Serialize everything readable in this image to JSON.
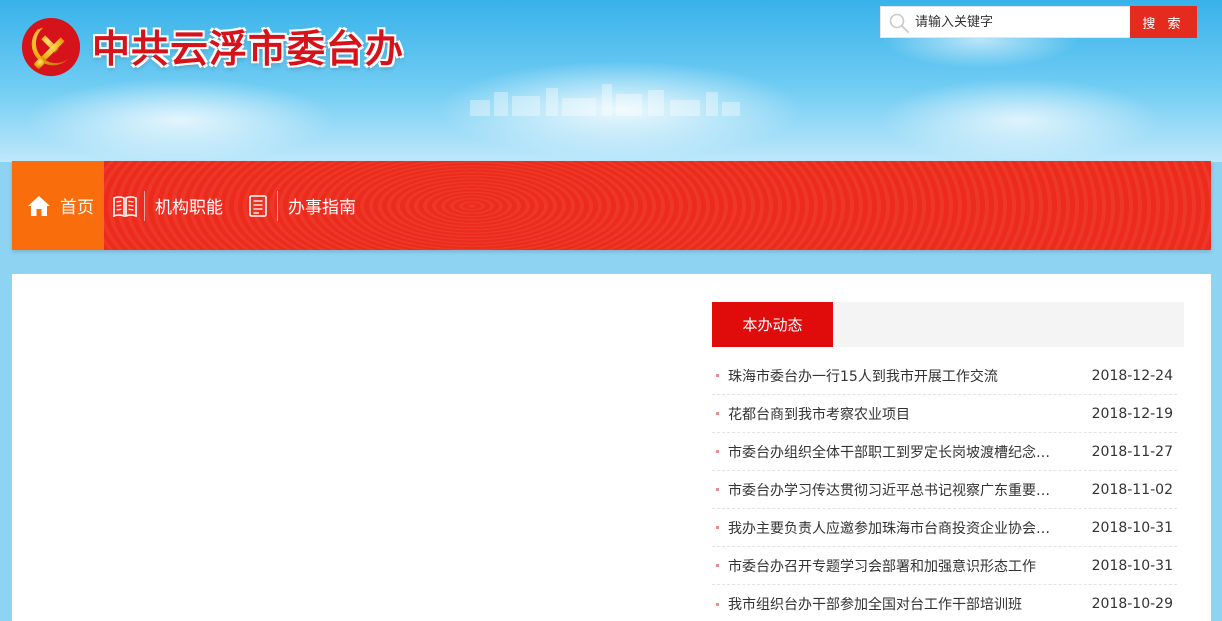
{
  "header": {
    "site_title": "中共云浮市委台办",
    "logo_icon": "party-emblem-icon"
  },
  "search": {
    "placeholder": "请输入关键字",
    "button_label": "搜 索",
    "icon": "search-icon"
  },
  "nav": {
    "items": [
      {
        "label": "首页",
        "icon": "home-icon",
        "active": true
      },
      {
        "label": "机构职能",
        "icon": "book-icon",
        "active": false
      },
      {
        "label": "办事指南",
        "icon": "document-icon",
        "active": false
      }
    ]
  },
  "news": {
    "tab_label": "本办动态",
    "items": [
      {
        "title": "珠海市委台办一行15人到我市开展工作交流",
        "date": "2018-12-24"
      },
      {
        "title": "花都台商到我市考察农业项目",
        "date": "2018-12-19"
      },
      {
        "title": "市委台办组织全体干部职工到罗定长岗坡渡槽纪念馆...",
        "date": "2018-11-27"
      },
      {
        "title": "市委台办学习传达贯彻习近平总书记视察广东重要讲...",
        "date": "2018-11-02"
      },
      {
        "title": "我办主要负责人应邀参加珠海市台商投资企业协会成...",
        "date": "2018-10-31"
      },
      {
        "title": "市委台办召开专题学习会部署和加强意识形态工作",
        "date": "2018-10-31"
      },
      {
        "title": "我市组织台办干部参加全国对台工作干部培训班",
        "date": "2018-10-29"
      }
    ]
  },
  "colors": {
    "primary_red": "#ec2b1c",
    "active_orange": "#fa6d0d",
    "tab_red": "#e00b0b"
  }
}
